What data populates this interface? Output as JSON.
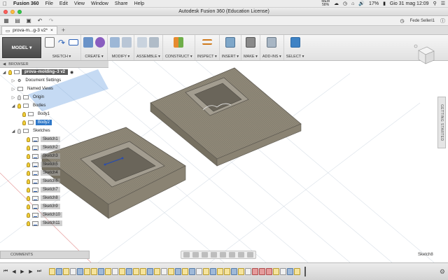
{
  "menubar": {
    "app_name": "Fusion 360",
    "menus": [
      "File",
      "Edit",
      "View",
      "Window",
      "Share",
      "Help"
    ],
    "memory_label": "MEM",
    "memory_value": "58%",
    "battery": "17%",
    "clock": "Gio 31 mag  12:09"
  },
  "window": {
    "title": "Autodesk Fusion 360 (Education License)"
  },
  "appbar": {
    "user": "Fede Selleri1"
  },
  "tabs": {
    "active_label": "prova-m...g-3 v2*"
  },
  "toolbar": {
    "workspace": "MODEL",
    "groups": [
      {
        "label": "SKETCH ▾"
      },
      {
        "label": "CREATE ▾"
      },
      {
        "label": "MODIFY ▾"
      },
      {
        "label": "ASSEMBLE ▾"
      },
      {
        "label": "CONSTRUCT ▾"
      },
      {
        "label": "INSPECT ▾"
      },
      {
        "label": "INSERT ▾"
      },
      {
        "label": "MAKE ▾"
      },
      {
        "label": "ADD-INS ▾"
      },
      {
        "label": "SELECT ▾"
      }
    ]
  },
  "browser": {
    "header": "BROWSER",
    "root": "prova–molding–3 v2",
    "items": {
      "document_settings": "Document Settings",
      "named_views": "Named Views",
      "origin": "Origin",
      "bodies": "Bodies",
      "body1": "Body1",
      "body2": "Body2",
      "sketches": "Sketches"
    },
    "sketches": [
      "Sketch1",
      "Sketch2",
      "Sketch3",
      "Sketch5",
      "Sketch4",
      "Sketch6",
      "Sketch7",
      "Sketch8",
      "Sketch9",
      "Sketch10",
      "Sketch11"
    ]
  },
  "panel": {
    "comments": "COMMENTS",
    "getting_started": "GETTING STARTED",
    "status": "Sketch8"
  },
  "colors": {
    "accent": "#2f78c8",
    "model_face": "#8c8577",
    "model_edge": "#5e5a52"
  }
}
